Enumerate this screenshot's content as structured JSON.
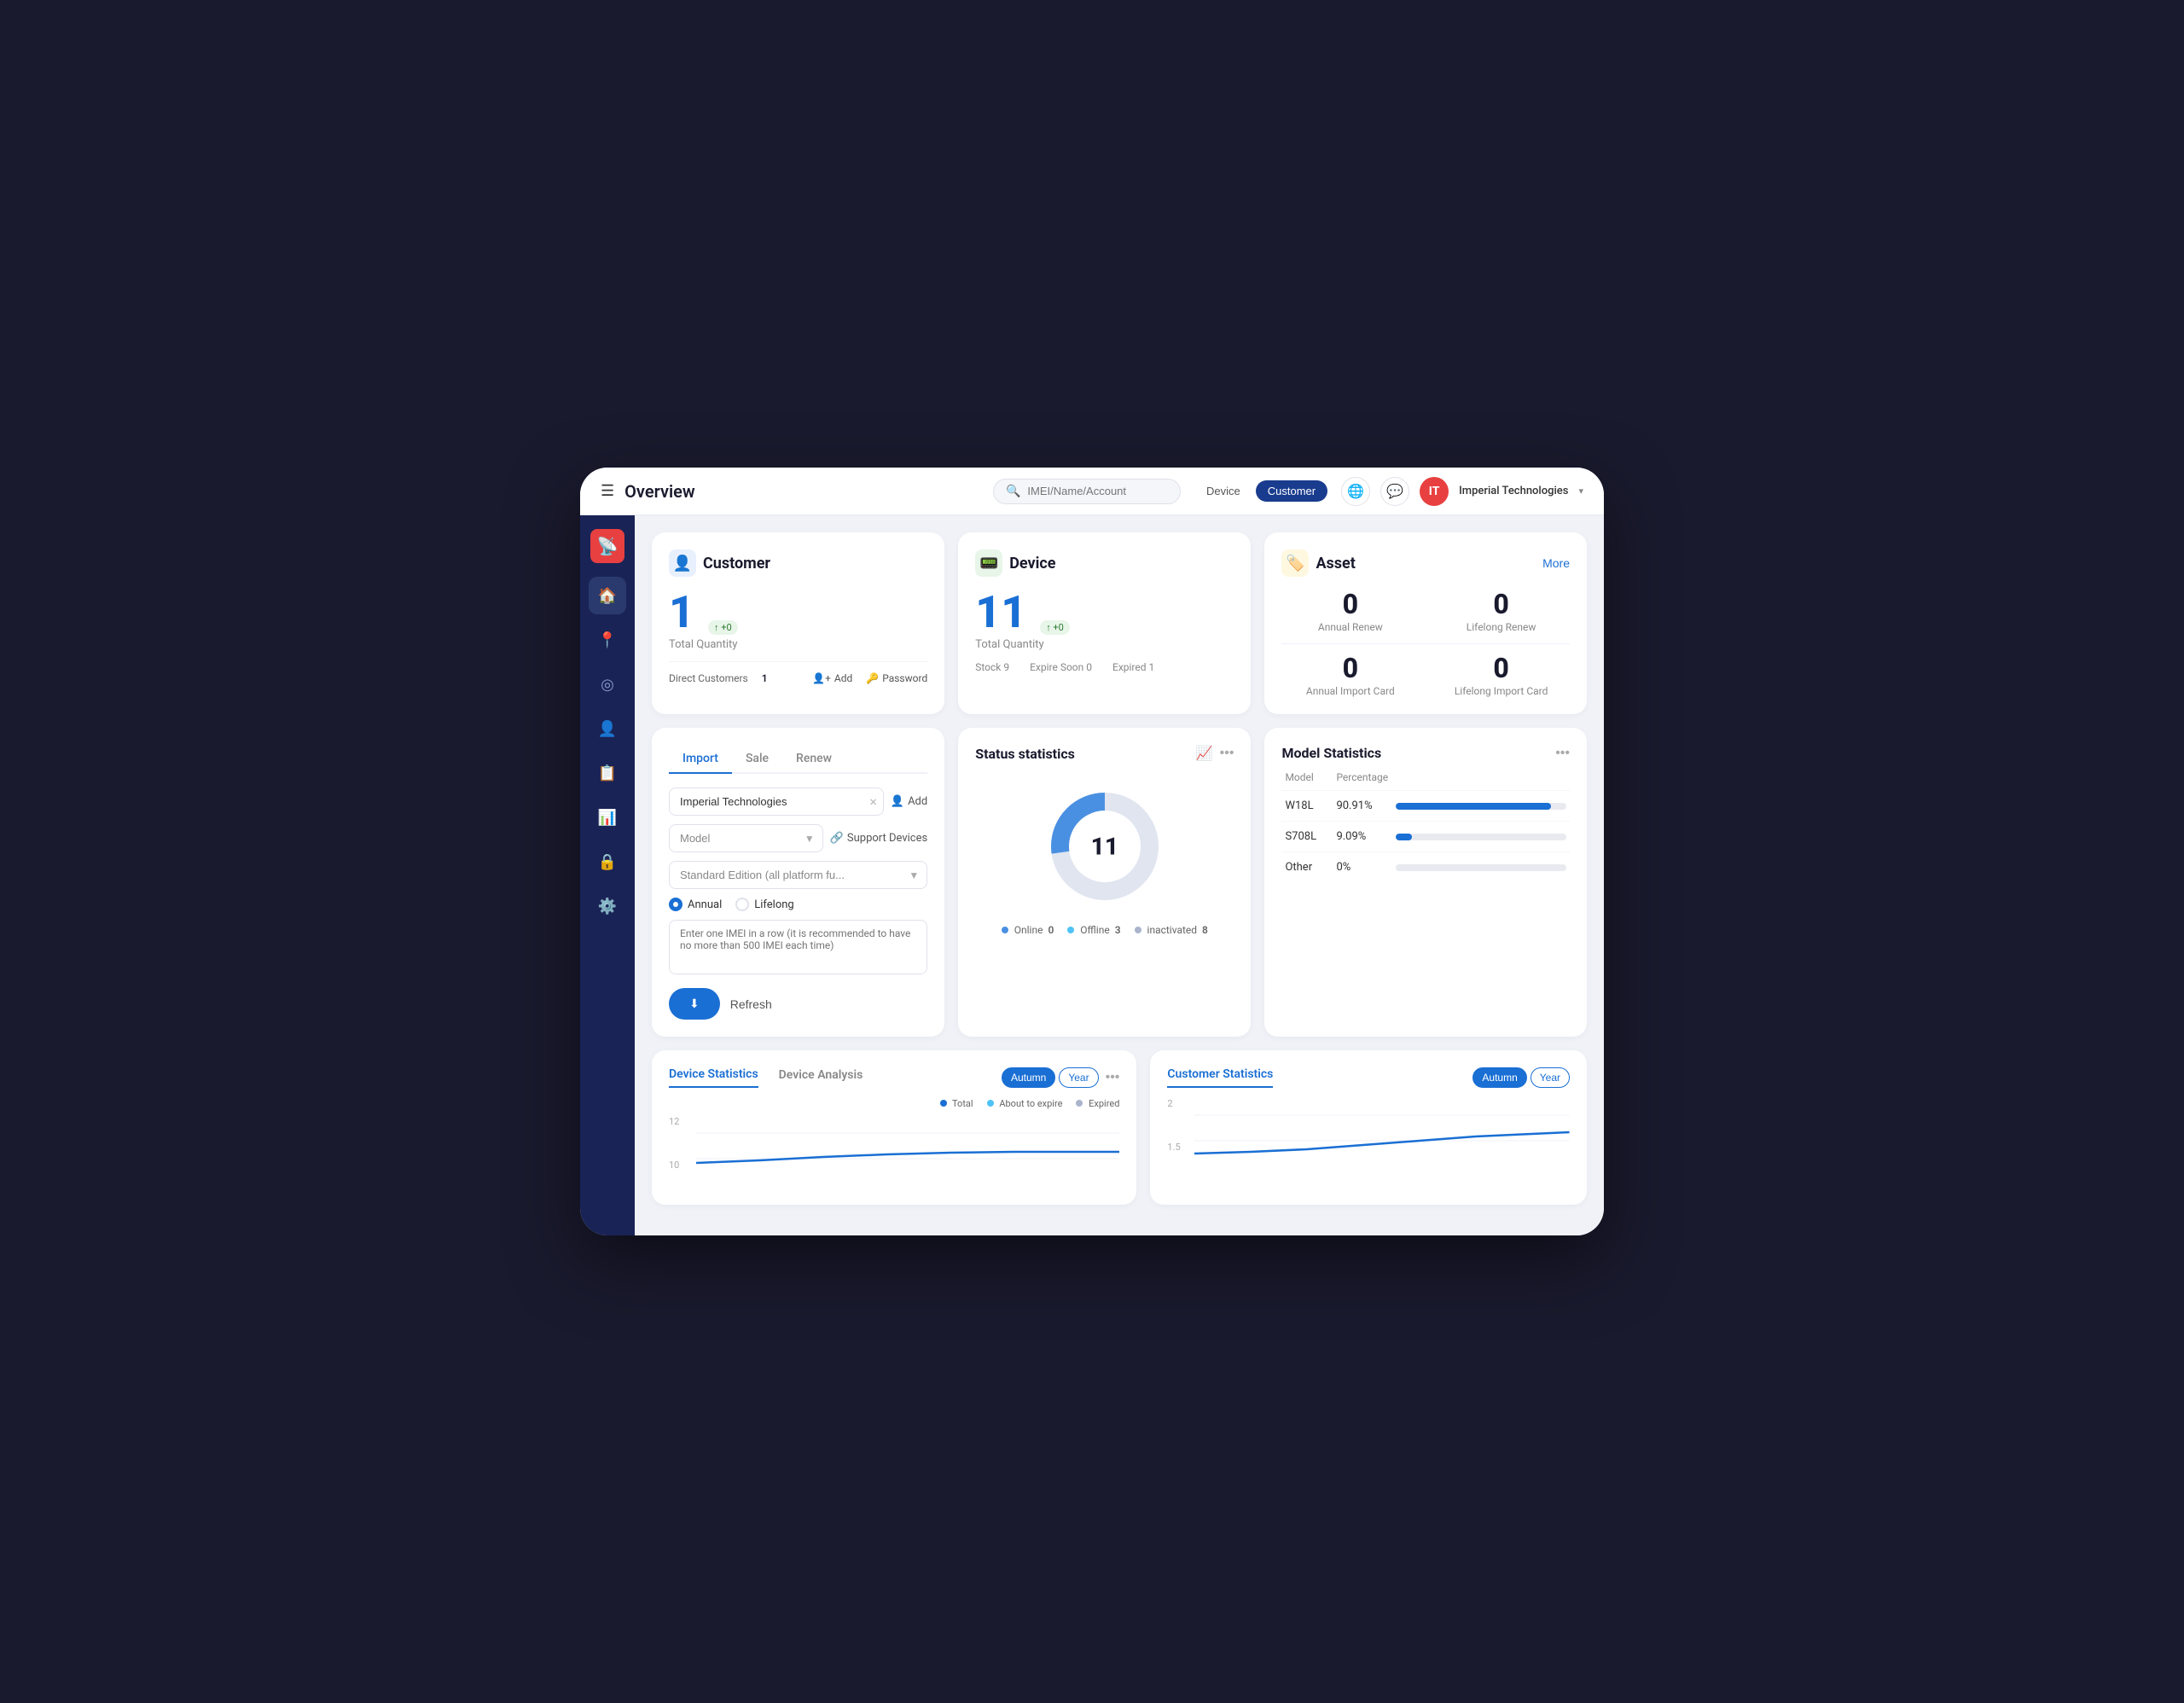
{
  "topbar": {
    "menu_icon": "☰",
    "title": "Overview",
    "search_placeholder": "IMEI/Name/Account",
    "pill_device": "Device",
    "pill_customer": "Customer",
    "active_pill": "customer",
    "globe_icon": "🌐",
    "chat_icon": "💬",
    "user_initials": "IT",
    "user_name": "Imperial Technologies",
    "dropdown_arrow": "▾"
  },
  "sidebar": {
    "items": [
      {
        "icon": "📡",
        "name": "logo",
        "active": false
      },
      {
        "icon": "🏠",
        "name": "home",
        "active": true
      },
      {
        "icon": "📍",
        "name": "location",
        "active": false
      },
      {
        "icon": "◎",
        "name": "tracking",
        "active": false
      },
      {
        "icon": "👤",
        "name": "users",
        "active": false
      },
      {
        "icon": "📋",
        "name": "reports",
        "active": false
      },
      {
        "icon": "📊",
        "name": "analytics",
        "active": false
      },
      {
        "icon": "🔒",
        "name": "security",
        "active": false
      },
      {
        "icon": "⚙️",
        "name": "settings",
        "active": false
      }
    ]
  },
  "customer_card": {
    "icon": "👤",
    "title": "Customer",
    "total_quantity": "1",
    "total_label": "Total Quantity",
    "badge": "↑ +0",
    "direct_customers_label": "Direct Customers",
    "direct_customers_value": "1",
    "add_label": "Add",
    "password_label": "Password"
  },
  "device_card": {
    "icon": "📟",
    "title": "Device",
    "total_quantity": "11",
    "total_label": "Total Quantity",
    "badge": "↑ +0",
    "stock_label": "Stock",
    "stock_value": "9",
    "expire_soon_label": "Expire Soon",
    "expire_soon_value": "0",
    "expired_label": "Expired",
    "expired_value": "1"
  },
  "asset_card": {
    "icon": "🏷️",
    "title": "Asset",
    "more_label": "More",
    "annual_renew_label": "Annual Renew",
    "annual_renew_value": "0",
    "lifelong_renew_label": "Lifelong Renew",
    "lifelong_renew_value": "0",
    "annual_import_label": "Annual Import Card",
    "annual_import_value": "0",
    "lifelong_import_label": "Lifelong Import Card",
    "lifelong_import_value": "0"
  },
  "import_form": {
    "tabs": [
      "Import",
      "Sale",
      "Renew"
    ],
    "active_tab": 0,
    "company_value": "Imperial Technologies",
    "model_placeholder": "Model",
    "edition_value": "Standard Edition (all platform fu...",
    "add_label": "Add",
    "support_label": "Support Devices",
    "radio_annual": "Annual",
    "radio_lifelong": "Lifelong",
    "radio_annual_checked": true,
    "textarea_placeholder": "Enter one IMEI in a row (it is recommended to have no more than 500 IMEI each time)",
    "submit_icon": "⬇",
    "refresh_label": "Refresh"
  },
  "status_card": {
    "title": "Status statistics",
    "donut_total": "11",
    "online_label": "Online",
    "online_value": "0",
    "offline_label": "Offline",
    "offline_value": "3",
    "inactivated_label": "inactivated",
    "inactivated_value": "8",
    "colors": {
      "online": "#4a90e2",
      "offline": "#4fc3f7",
      "inactivated": "#e0e5f0"
    },
    "segments": [
      {
        "value": 0,
        "color": "#4a90e2"
      },
      {
        "value": 3,
        "color": "#4fc3f7"
      },
      {
        "value": 8,
        "color": "#e0e5f0"
      }
    ]
  },
  "model_stats": {
    "title": "Model Statistics",
    "col_model": "Model",
    "col_percentage": "Percentage",
    "rows": [
      {
        "name": "W18L",
        "pct": "90.91%",
        "fill": 90.91
      },
      {
        "name": "S708L",
        "pct": "9.09%",
        "fill": 9.09
      },
      {
        "name": "Other",
        "pct": "0%",
        "fill": 0
      }
    ],
    "bar_color": "#1a6fd4",
    "bar_bg": "#e8eaf0"
  },
  "device_stats": {
    "tab1": "Device Statistics",
    "tab2": "Device Analysis",
    "active_tab": 0,
    "period_autumn": "Autumn",
    "period_year": "Year",
    "active_period": "autumn",
    "legend": [
      {
        "label": "Total",
        "color": "#1a6fd4"
      },
      {
        "label": "About to expire",
        "color": "#4fc3f7"
      },
      {
        "label": "Expired",
        "color": "#aab"
      }
    ],
    "y_labels": [
      "12",
      "10"
    ],
    "chart_value": 11
  },
  "customer_stats": {
    "title": "Customer Statistics",
    "period_autumn": "Autumn",
    "period_year": "Year",
    "active_period": "autumn",
    "y_labels": [
      "2",
      "1.5"
    ],
    "chart_value": 1
  }
}
